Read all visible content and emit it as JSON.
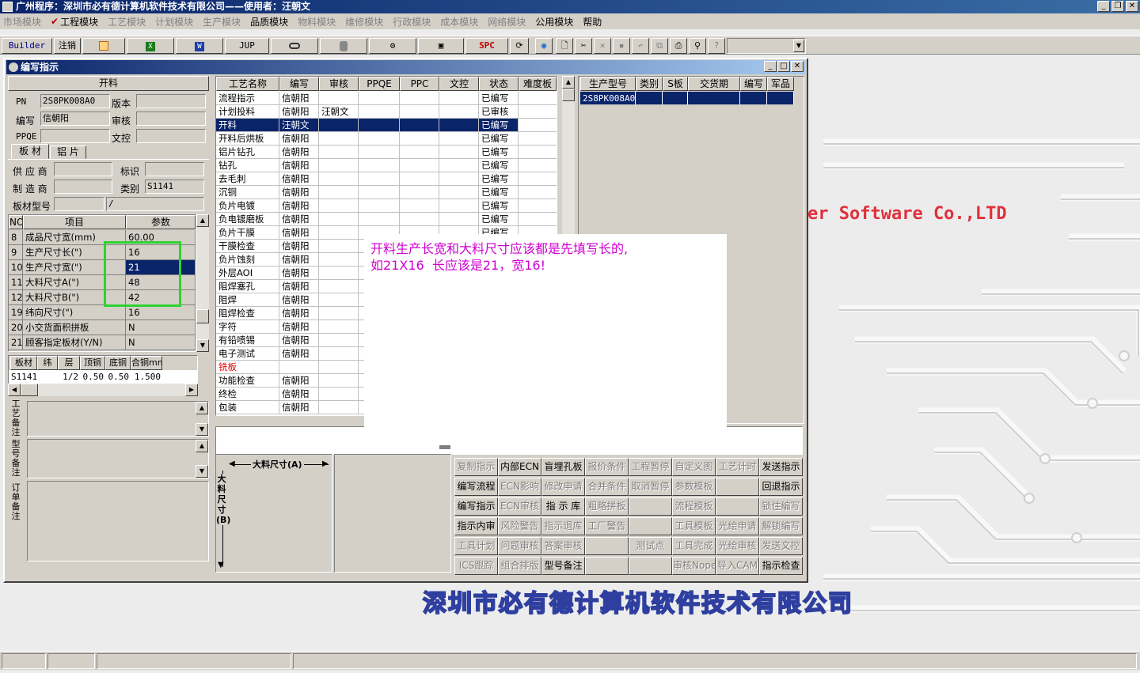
{
  "app": {
    "title": "广州程序：深圳市必有德计算机软件技术有限公司——使用者：汪朝文"
  },
  "menu": {
    "items": [
      {
        "label": "市场模块",
        "disabled": true
      },
      {
        "label": "工程模块",
        "disabled": false,
        "checked": true
      },
      {
        "label": "工艺模块",
        "disabled": true
      },
      {
        "label": "计划模块",
        "disabled": true
      },
      {
        "label": "生产模块",
        "disabled": true
      },
      {
        "label": "品质模块",
        "disabled": false
      },
      {
        "label": "物料模块",
        "disabled": true
      },
      {
        "label": "维修模块",
        "disabled": true
      },
      {
        "label": "行政模块",
        "disabled": true
      },
      {
        "label": "成本模块",
        "disabled": true
      },
      {
        "label": "网络模块",
        "disabled": true
      },
      {
        "label": "公用模块",
        "disabled": false
      },
      {
        "label": "帮助",
        "disabled": false
      }
    ]
  },
  "toolbar": {
    "builder": "Builder",
    "logout": "注销",
    "jup": "JUP",
    "spc": "SPC"
  },
  "window": {
    "title": "编写指示"
  },
  "header_form": {
    "section_title": "开料",
    "pn_label": "PN",
    "pn_value": "2S8PK008A0",
    "version_label": "版本",
    "version_value": "",
    "writer_label": "编写",
    "writer_value": "信朝阳",
    "review_label": "审核",
    "review_value": "",
    "ppqe_label": "PPQE",
    "ppqe_value": "",
    "wenkong_label": "文控",
    "wenkong_value": ""
  },
  "tabs": {
    "board": "板 材",
    "aluminum": "铝 片"
  },
  "board_form": {
    "supplier_label": "供 应 商",
    "supplier_value": "",
    "mark_label": "标识",
    "mark_value": "",
    "maker_label": "制 造 商",
    "maker_value": "",
    "category_label": "类别",
    "category_value": "S1141",
    "type_label": "板材型号",
    "type_value": "",
    "type_value2": "/"
  },
  "param_table": {
    "headers": [
      "NO",
      "项目",
      "参数"
    ],
    "rows": [
      {
        "no": "8",
        "item": "成品尺寸宽(mm)",
        "value": "60.00",
        "selected": false
      },
      {
        "no": "9",
        "item": "生产尺寸长(\")",
        "value": "16",
        "selected": false
      },
      {
        "no": "10",
        "item": "生产尺寸宽(\")",
        "value": "21",
        "selected": true
      },
      {
        "no": "11",
        "item": "大料尺寸A(\")",
        "value": "48",
        "selected": false
      },
      {
        "no": "12",
        "item": "大料尺寸B(\")",
        "value": "42",
        "selected": false
      },
      {
        "no": "19",
        "item": "纬向尺寸(\")",
        "value": "16",
        "selected": false
      },
      {
        "no": "20",
        "item": "小交货面积拼板",
        "value": "N",
        "selected": false
      },
      {
        "no": "21",
        "item": "顾客指定板材(Y/N)",
        "value": "N",
        "selected": false
      }
    ]
  },
  "material_table": {
    "headers": [
      "板材",
      "纬",
      "层",
      "顶铜",
      "底铜",
      "合铜mm"
    ],
    "rows": [
      {
        "board": "S1141",
        "weft": "",
        "layer": "1/2",
        "top": "0.50",
        "bottom": "0.50",
        "total": "1.500"
      }
    ]
  },
  "remarks": {
    "process": "工艺备注",
    "model": "型号备注",
    "order": "订单备注"
  },
  "process_table": {
    "headers": [
      "工艺名称",
      "编写",
      "审核",
      "PPQE",
      "PPC",
      "文控",
      "状态",
      "难度板"
    ],
    "rows": [
      {
        "name": "流程指示",
        "writer": "信朝阳",
        "reviewer": "",
        "status": "已编写",
        "red": false,
        "selected": false
      },
      {
        "name": "计划投料",
        "writer": "信朝阳",
        "reviewer": "汪朝文",
        "status": "已审核",
        "red": false,
        "selected": false
      },
      {
        "name": "开料",
        "writer": "汪朝文",
        "reviewer": "",
        "status": "已编写",
        "red": false,
        "selected": true
      },
      {
        "name": "开料后烘板",
        "writer": "信朝阳",
        "reviewer": "",
        "status": "已编写",
        "red": false,
        "selected": false
      },
      {
        "name": "铝片钻孔",
        "writer": "信朝阳",
        "reviewer": "",
        "status": "已编写",
        "red": false,
        "selected": false
      },
      {
        "name": "钻孔",
        "writer": "信朝阳",
        "reviewer": "",
        "status": "已编写",
        "red": false,
        "selected": false
      },
      {
        "name": "去毛刺",
        "writer": "信朝阳",
        "reviewer": "",
        "status": "已编写",
        "red": false,
        "selected": false
      },
      {
        "name": "沉铜",
        "writer": "信朝阳",
        "reviewer": "",
        "status": "已编写",
        "red": false,
        "selected": false
      },
      {
        "name": "负片电镀",
        "writer": "信朝阳",
        "reviewer": "",
        "status": "已编写",
        "red": false,
        "selected": false
      },
      {
        "name": "负电镀磨板",
        "writer": "信朝阳",
        "reviewer": "",
        "status": "已编写",
        "red": false,
        "selected": false
      },
      {
        "name": "负片干膜",
        "writer": "信朝阳",
        "reviewer": "",
        "status": "已编写",
        "red": false,
        "selected": false
      },
      {
        "name": "干膜检查",
        "writer": "信朝阳",
        "reviewer": "",
        "status": "",
        "red": false,
        "selected": false
      },
      {
        "name": "负片蚀刻",
        "writer": "信朝阳",
        "reviewer": "",
        "status": "",
        "red": false,
        "selected": false
      },
      {
        "name": "外层AOI",
        "writer": "信朝阳",
        "reviewer": "",
        "status": "",
        "red": false,
        "selected": false
      },
      {
        "name": "阻焊塞孔",
        "writer": "信朝阳",
        "reviewer": "",
        "status": "",
        "red": false,
        "selected": false
      },
      {
        "name": "阻焊",
        "writer": "信朝阳",
        "reviewer": "",
        "status": "",
        "red": false,
        "selected": false
      },
      {
        "name": "阻焊检查",
        "writer": "信朝阳",
        "reviewer": "",
        "status": "",
        "red": false,
        "selected": false
      },
      {
        "name": "字符",
        "writer": "信朝阳",
        "reviewer": "",
        "status": "",
        "red": false,
        "selected": false
      },
      {
        "name": "有铅喷锡",
        "writer": "信朝阳",
        "reviewer": "",
        "status": "",
        "red": false,
        "selected": false
      },
      {
        "name": "电子测试",
        "writer": "信朝阳",
        "reviewer": "",
        "status": "",
        "red": false,
        "selected": false
      },
      {
        "name": "铣板",
        "writer": "",
        "reviewer": "",
        "status": "",
        "red": true,
        "selected": false
      },
      {
        "name": "功能检查",
        "writer": "信朝阳",
        "reviewer": "",
        "status": "",
        "red": false,
        "selected": false
      },
      {
        "name": "终检",
        "writer": "信朝阳",
        "reviewer": "",
        "status": "",
        "red": false,
        "selected": false
      },
      {
        "name": "包装",
        "writer": "信朝阳",
        "reviewer": "",
        "status": "",
        "red": false,
        "selected": false
      }
    ]
  },
  "model_table": {
    "headers": [
      "生产型号",
      "类别",
      "S板",
      "交货期",
      "编写",
      "军品"
    ],
    "rows": [
      {
        "model": "2S8PK008A0"
      }
    ]
  },
  "diagram": {
    "a_label": "大料尺寸(A)",
    "b_label": "大料尺寸(B)"
  },
  "buttons": [
    [
      {
        "label": "复制指示",
        "disabled": true
      },
      {
        "label": "内部ECN",
        "disabled": false
      },
      {
        "label": "盲埋孔板",
        "disabled": false
      },
      {
        "label": "报价条件",
        "disabled": true
      },
      {
        "label": "工程暂停",
        "disabled": true
      },
      {
        "label": "自定义图",
        "disabled": true
      },
      {
        "label": "工艺计时",
        "disabled": true
      },
      {
        "label": "发送指示",
        "disabled": false
      }
    ],
    [
      {
        "label": "编写流程",
        "disabled": false
      },
      {
        "label": "ECN影响",
        "disabled": true
      },
      {
        "label": "修改申请",
        "disabled": true
      },
      {
        "label": "合并条件",
        "disabled": true
      },
      {
        "label": "取消暂停",
        "disabled": true
      },
      {
        "label": "参数模板",
        "disabled": true
      },
      {
        "label": "",
        "disabled": true
      },
      {
        "label": "回退指示",
        "disabled": false
      }
    ],
    [
      {
        "label": "编写指示",
        "disabled": false
      },
      {
        "label": "ECN审核",
        "disabled": true
      },
      {
        "label": "指 示 库",
        "disabled": false
      },
      {
        "label": "粗略拼板",
        "disabled": true
      },
      {
        "label": "",
        "disabled": true
      },
      {
        "label": "流程模板",
        "disabled": true
      },
      {
        "label": "",
        "disabled": true
      },
      {
        "label": "锁住编写",
        "disabled": true
      }
    ],
    [
      {
        "label": "指示内审",
        "disabled": false
      },
      {
        "label": "风险警告",
        "disabled": true
      },
      {
        "label": "指示退库",
        "disabled": true
      },
      {
        "label": "工厂警告",
        "disabled": true
      },
      {
        "label": "",
        "disabled": true
      },
      {
        "label": "工具模板",
        "disabled": true
      },
      {
        "label": "光绘申请",
        "disabled": true
      },
      {
        "label": "解锁编写",
        "disabled": true
      }
    ],
    [
      {
        "label": "工具计划",
        "disabled": true
      },
      {
        "label": "问题审核",
        "disabled": true
      },
      {
        "label": "答案审核",
        "disabled": true
      },
      {
        "label": "",
        "disabled": true
      },
      {
        "label": "测试点",
        "disabled": true
      },
      {
        "label": "工具完成",
        "disabled": true
      },
      {
        "label": "光绘审核",
        "disabled": true
      },
      {
        "label": "发送文控",
        "disabled": true
      }
    ],
    [
      {
        "label": "ICS跟踪",
        "disabled": true
      },
      {
        "label": "组合排版",
        "disabled": true
      },
      {
        "label": "型号备注",
        "disabled": false
      },
      {
        "label": "",
        "disabled": true
      },
      {
        "label": "",
        "disabled": true
      },
      {
        "label": "审核Nope",
        "disabled": true
      },
      {
        "label": "导入CAM",
        "disabled": true
      },
      {
        "label": "指示检查",
        "disabled": false
      }
    ]
  ],
  "popup": {
    "note": "开料生产长宽和大料尺寸应该都是先填写长的,\n如21X16  长应该是21，宽16!"
  },
  "background": {
    "english_fragment": "er Software Co.,LTD",
    "company_cn": "深圳市必有德计算机软件技术有限公司"
  },
  "colors": {
    "selection": "#0a246a",
    "popup_text": "#d000d0",
    "highlight_box": "#2dd32d",
    "bg_english": "#e0303a"
  }
}
